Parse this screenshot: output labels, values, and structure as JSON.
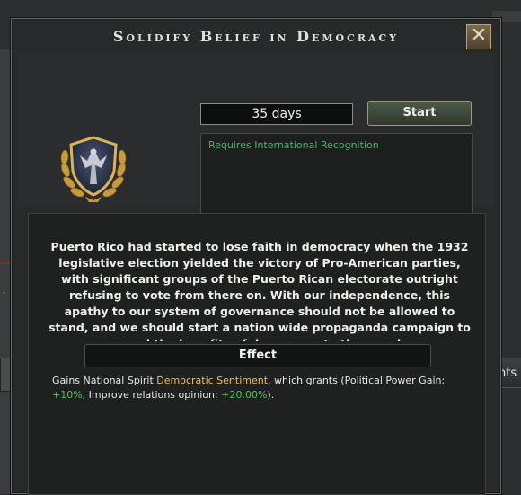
{
  "window": {
    "title": "Solidify Belief in Democracy",
    "close_label": "✕"
  },
  "decision": {
    "duration": "35 days",
    "start_label": "Start",
    "requirement": "Requires International Recognition",
    "description": "Puerto Rico had started to lose faith in democracy when the 1932 legislative election yielded the victory of Pro-American parties, with significant groups of the Puerto Rican electorate outright refusing to vote from there on. With our independence, this apathy to our system of governance should not be allowed to stand, and we should start a nation wide propaganda campaign to spread the benefits of democracy to the people.",
    "effect_header": "Effect",
    "effect": {
      "prefix": "Gains National Spirit ",
      "spirit_name": "Democratic Sentiment",
      "mid": ", which grants (Political Power Gain: ",
      "political_power": "+10%",
      "mid2": ", Improve relations opinion: ",
      "relations": "+20.00%",
      "suffix": ")."
    }
  },
  "background": {
    "right_button_label": "nts"
  },
  "colors": {
    "requirement_green": "#4fb06a",
    "spirit_gold": "#e5c24a",
    "modifier_green": "#4fbf5d"
  }
}
